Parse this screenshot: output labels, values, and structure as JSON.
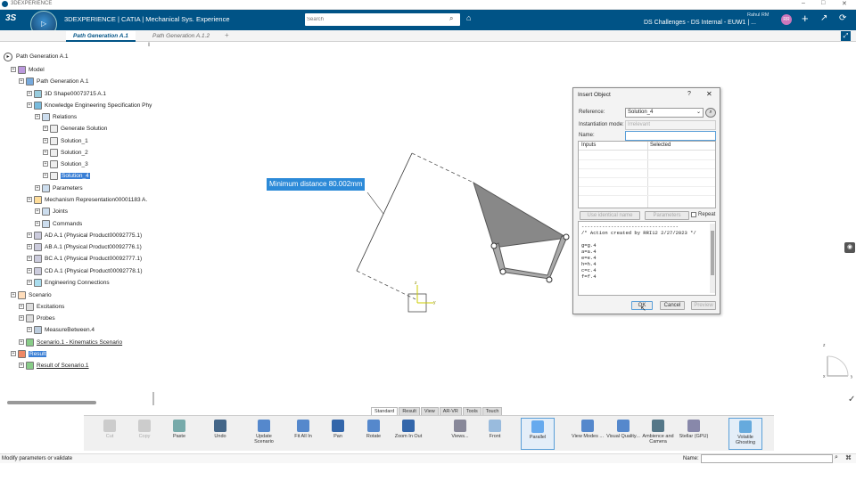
{
  "window": {
    "title": "3DEXPERIENCE",
    "controls": [
      "–",
      "□",
      "✕"
    ]
  },
  "appbar": {
    "brand": "3DEXPERIENCE | CATIA | Mechanical Sys. Experience",
    "compass_label": "V,R",
    "search_placeholder": "Search",
    "user": "Rahul RM",
    "tenant": "DS Challenges - DS Internal - EUW1 | ...",
    "user_initials": "RR"
  },
  "tabs": [
    {
      "label": "Path Generation A.1",
      "active": true
    },
    {
      "label": "Path Generation A.1.2",
      "active": false
    }
  ],
  "tree": {
    "root": "Path Generation A.1",
    "nodes": [
      {
        "label": "Model",
        "depth": 0
      },
      {
        "label": "Path Generation A.1",
        "depth": 1
      },
      {
        "label": "3D Shape00073715 A.1",
        "depth": 2
      },
      {
        "label": "Knowledge Engineering Specification Phy",
        "depth": 2
      },
      {
        "label": "Relations",
        "depth": 3
      },
      {
        "label": "Generate Solution",
        "depth": 4
      },
      {
        "label": "Solution_1",
        "depth": 4
      },
      {
        "label": "Solution_2",
        "depth": 4
      },
      {
        "label": "Solution_3",
        "depth": 4
      },
      {
        "label": "Solution_4",
        "depth": 4,
        "selected": true
      },
      {
        "label": "Parameters",
        "depth": 3
      },
      {
        "label": "Mechanism Representation00001183 A.",
        "depth": 2
      },
      {
        "label": "Joints",
        "depth": 3
      },
      {
        "label": "Commands",
        "depth": 3
      },
      {
        "label": "AD A.1 (Physical Product00092775.1)",
        "depth": 2
      },
      {
        "label": "AB A.1 (Physical Product00092776.1)",
        "depth": 2
      },
      {
        "label": "BC A.1 (Physical Product00092777.1)",
        "depth": 2
      },
      {
        "label": "CD A.1 (Physical Product00092778.1)",
        "depth": 2
      },
      {
        "label": "Engineering Connections",
        "depth": 2
      },
      {
        "label": "Scenario",
        "depth": 0
      },
      {
        "label": "Excitations",
        "depth": 1
      },
      {
        "label": "Probes",
        "depth": 1
      },
      {
        "label": "MeasureBetween.4",
        "depth": 2
      },
      {
        "label": "Scenario.1 - Kinematics Scenario",
        "depth": 1,
        "underline": true
      },
      {
        "label": "Result",
        "depth": 0,
        "selected": true
      },
      {
        "label": "Result of Scenario.1",
        "depth": 1,
        "underline": true
      }
    ]
  },
  "viewport": {
    "measure_label": "Minimum distance 80.002mm",
    "axis_labels": {
      "x": "x",
      "y": "y",
      "z": "z"
    }
  },
  "dialog": {
    "title": "Insert Object",
    "help": "?",
    "reference_label": "Reference:",
    "reference_value": "Solution_4",
    "mode_label": "Instantiation mode:",
    "mode_value": "Irrelevant",
    "name_label": "Name:",
    "name_value": "",
    "col_inputs": "Inputs",
    "col_selected": "Selected",
    "use_identical": "Use identical name",
    "parameters": "Parameters",
    "repeat": "Repeat",
    "code_lines": [
      "---------------------------------",
      "/* Action created by RRI12 2/27/2023 */",
      "",
      "g=g.4",
      "a=a.4",
      "e=e.4",
      "h=h.4",
      "c=c.4",
      "f=f.4"
    ],
    "ok": "OK",
    "cancel": "Cancel",
    "preview": "Preview"
  },
  "cmd_tabs": [
    {
      "label": "Standard",
      "on": true
    },
    {
      "label": "Result"
    },
    {
      "label": "View"
    },
    {
      "label": "AR-VR"
    },
    {
      "label": "Tools"
    },
    {
      "label": "Touch"
    }
  ],
  "toolbar": [
    {
      "label": "Cut",
      "dis": true
    },
    {
      "label": "Copy",
      "dis": true
    },
    {
      "label": "Paste"
    },
    {
      "label": "Undo"
    },
    {
      "label": "Update Scenario"
    },
    {
      "label": "Fit All In"
    },
    {
      "label": "Pan"
    },
    {
      "label": "Rotate"
    },
    {
      "label": "Zoom In Out"
    },
    {
      "label": "Views..."
    },
    {
      "label": "Front"
    },
    {
      "label": "Parallel"
    },
    {
      "label": "View Modes ..."
    },
    {
      "label": "Visual Quality..."
    },
    {
      "label": "Ambience and Camera"
    },
    {
      "label": "Stellar (GPU)"
    },
    {
      "label": "Volatile Ghosting"
    }
  ],
  "status": {
    "text": "Modify parameters or validate",
    "name_label": "Name:"
  }
}
